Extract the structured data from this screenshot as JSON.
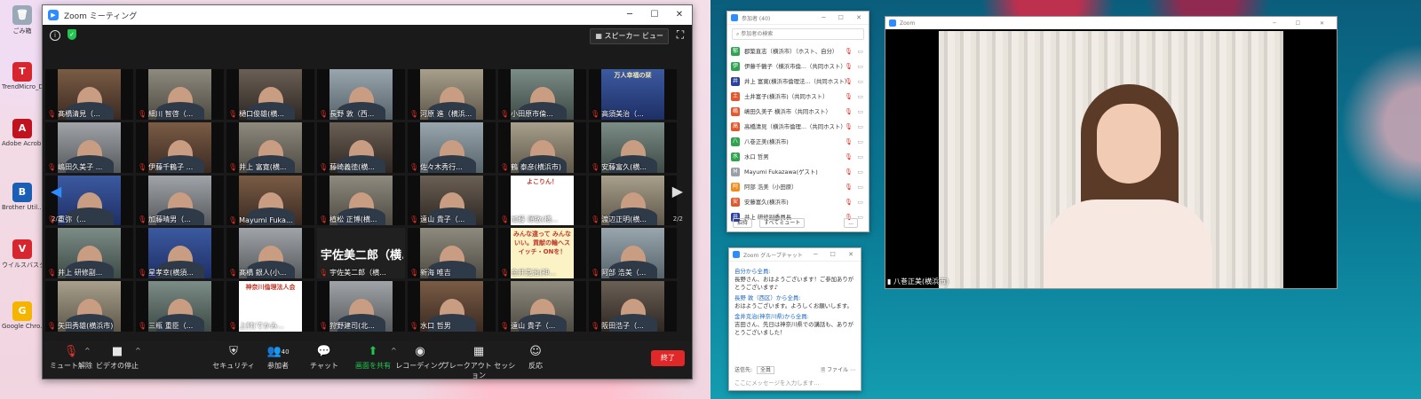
{
  "desktop": {
    "icons": [
      {
        "label": "ごみ箱",
        "glyph": "🗑",
        "color": "#9aa9b8"
      },
      {
        "label": "TrendMicro_D...",
        "glyph": "T",
        "color": "#d8262e"
      },
      {
        "label": "Adobe Acrob...",
        "glyph": "A",
        "color": "#c0131f"
      },
      {
        "label": "Brother Util...",
        "glyph": "B",
        "color": "#1a5fb4"
      },
      {
        "label": "ウイルスバスター",
        "glyph": "V",
        "color": "#d8262e"
      },
      {
        "label": "Google Chro...",
        "glyph": "G",
        "color": "#f4b400"
      }
    ]
  },
  "meeting": {
    "title": "Zoom ミーティング",
    "speaker_view_label": "スピーカー ビュー",
    "page_indicator": "2/2",
    "tiles": [
      "髙橋清見（...",
      "細川 智啓（...",
      "樋口俊雄(横...",
      "長野 敦（西...",
      "河原 進（横浜...",
      "小田原市倫...",
      "高須美治（...",
      "嶋田久美子 ...",
      "伊藤千鶴子 ...",
      "井上 富寛(横...",
      "藤崎義徳(横...",
      "佐々木秀行...",
      "鶴 泰彦(横浜市)",
      "安藤富久(横...",
      "重弥（...",
      "加藤晴男（...",
      "Mayumi Fuka...",
      "植松 正博(横...",
      "遠山 貴子（...",
      "加藤 順敏(横...",
      "渡辺正明(横...",
      "井上 研修副...",
      "星孝幸(横須...",
      "髙橋 銀人(小...",
      "宇佐美二郎（横...",
      "新海 唯吉",
      "金井克治(神...",
      "阿部 浩美（...",
      "矢田秀雄(横浜市)",
      "三瓶 重臣（...",
      "上村(でかみ...",
      "狩野建司(北...",
      "水口 哲男",
      "遠山 貴子（...",
      "阪田浩子（..."
    ],
    "tile_overlays": {
      "t6": "万人幸福の栞",
      "t19": "よこりん！",
      "t26": "みんな違って みんないい。貢献の輪へスイッチ・ONを！",
      "t30": "神奈川倫理法人会"
    },
    "toolbar": {
      "mute": "ミュート解除",
      "video": "ビデオの停止",
      "security": "セキュリティ",
      "participants": "参加者",
      "participant_count": "40",
      "chat": "チャット",
      "share": "画面を共有",
      "record": "レコーディング",
      "breakout": "ブレークアウト セッション",
      "reactions": "反応",
      "end": "終了"
    }
  },
  "participants_panel": {
    "title": "参加者 (40)",
    "search_placeholder": "参加者の検索",
    "rows": [
      {
        "av": "郁",
        "color": "#2fa44f",
        "name": "郡築直志（横浜市）（ホスト、自分）"
      },
      {
        "av": "伊",
        "color": "#2fa44f",
        "name": "伊藤千鶴子（横浜市倫...（共同ホスト）"
      },
      {
        "av": "井",
        "color": "#2a3fa0",
        "name": "井上 富寛(横浜市倫理法...（共同ホスト）"
      },
      {
        "av": "土",
        "color": "#e2572b",
        "name": "土井富子(横浜市)（共同ホスト）"
      },
      {
        "av": "嶋",
        "color": "#e2572b",
        "name": "嶋田久美子 横浜市（共同ホスト）"
      },
      {
        "av": "高",
        "color": "#e2572b",
        "name": "高橋清見（横浜市倫理...（共同ホスト）"
      },
      {
        "av": "八",
        "color": "#2fa44f",
        "name": "八巻正美(横浜市)"
      },
      {
        "av": "水",
        "color": "#2fa44f",
        "name": "水口 哲男"
      },
      {
        "av": "M",
        "color": "#9aa0a6",
        "name": "Mayumi Fukazawa(ゲスト)"
      },
      {
        "av": "阿",
        "color": "#f08c1e",
        "name": "阿部 浩美（小田原）"
      },
      {
        "av": "安",
        "color": "#e2572b",
        "name": "安藤富久(横浜市)"
      },
      {
        "av": "井",
        "color": "#2a3fa0",
        "name": "井上 研修副委員長"
      }
    ],
    "footer": {
      "invite": "招待",
      "mute_all": "すべてミュート",
      "more": "..."
    }
  },
  "chat_panel": {
    "title": "Zoom グループチャット",
    "messages": [
      {
        "from": "自分から全員:",
        "text": "長野さん、おはようございます！ご参加ありがとうございます♪"
      },
      {
        "from": "長野 敦（西区）から全員:",
        "text": "おはようございます。よろしくお願いします。"
      },
      {
        "from": "金井克治(神奈川県)から全員:",
        "text": "吉田さん、先日は神奈川県での講話も、ありがとうございました！"
      }
    ],
    "send_to_label": "送信先:",
    "send_to_value": "全員",
    "file_label": "ファイル",
    "input_placeholder": "ここにメッセージを入力します..."
  },
  "speaker_window": {
    "title": "Zoom",
    "name": "八巻正美(横浜市)"
  }
}
